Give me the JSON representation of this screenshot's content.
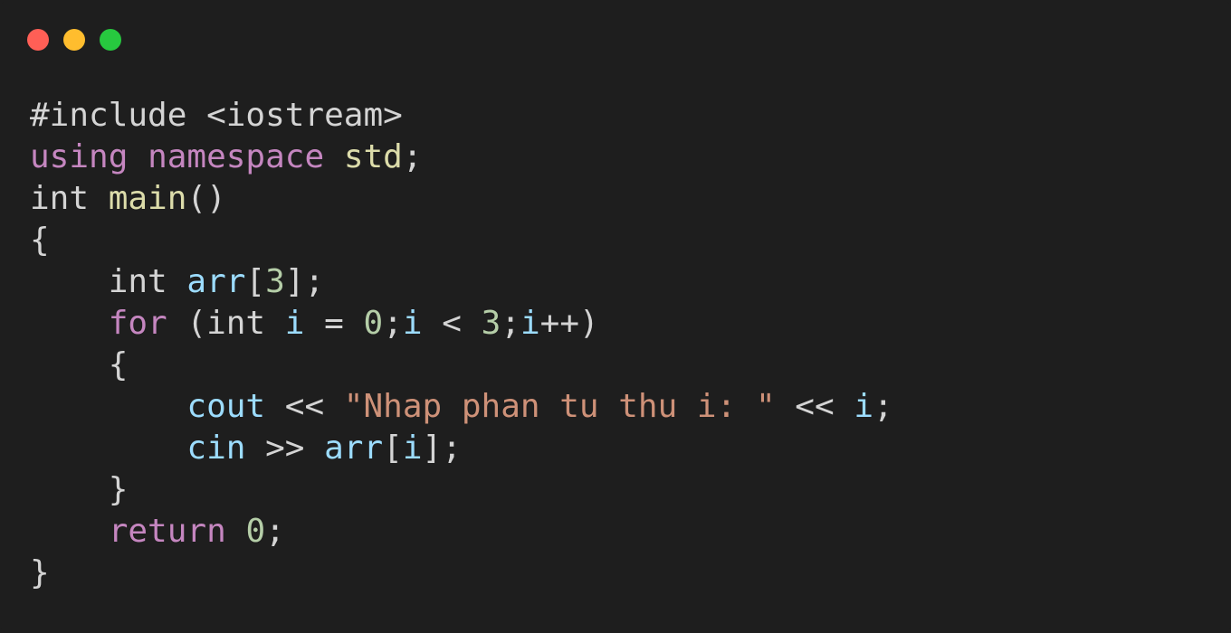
{
  "window": {
    "controls": [
      {
        "name": "close",
        "color": "#ff5f56"
      },
      {
        "name": "minimize",
        "color": "#ffbd2e"
      },
      {
        "name": "zoom",
        "color": "#27c93f"
      }
    ]
  },
  "code": {
    "language": "cpp",
    "lines": [
      [
        {
          "t": "#include <iostream>",
          "c": "plain"
        }
      ],
      [
        {
          "t": "using",
          "c": "kw"
        },
        {
          "t": " ",
          "c": "plain"
        },
        {
          "t": "namespace",
          "c": "kw"
        },
        {
          "t": " ",
          "c": "plain"
        },
        {
          "t": "std",
          "c": "fn"
        },
        {
          "t": ";",
          "c": "plain"
        }
      ],
      [
        {
          "t": "int ",
          "c": "plain"
        },
        {
          "t": "main",
          "c": "fn"
        },
        {
          "t": "()",
          "c": "plain"
        }
      ],
      [
        {
          "t": "{",
          "c": "plain"
        }
      ],
      [
        {
          "t": "    int ",
          "c": "plain"
        },
        {
          "t": "arr",
          "c": "var"
        },
        {
          "t": "[",
          "c": "plain"
        },
        {
          "t": "3",
          "c": "num"
        },
        {
          "t": "];",
          "c": "plain"
        }
      ],
      [
        {
          "t": "    ",
          "c": "plain"
        },
        {
          "t": "for",
          "c": "kw"
        },
        {
          "t": " (int ",
          "c": "plain"
        },
        {
          "t": "i",
          "c": "var"
        },
        {
          "t": " = ",
          "c": "plain"
        },
        {
          "t": "0",
          "c": "num"
        },
        {
          "t": ";",
          "c": "plain"
        },
        {
          "t": "i",
          "c": "var"
        },
        {
          "t": " < ",
          "c": "plain"
        },
        {
          "t": "3",
          "c": "num"
        },
        {
          "t": ";",
          "c": "plain"
        },
        {
          "t": "i",
          "c": "var"
        },
        {
          "t": "++)",
          "c": "plain"
        }
      ],
      [
        {
          "t": "    {",
          "c": "plain"
        }
      ],
      [
        {
          "t": "        ",
          "c": "plain"
        },
        {
          "t": "cout",
          "c": "var"
        },
        {
          "t": " << ",
          "c": "plain"
        },
        {
          "t": "\"Nhap phan tu thu i: \"",
          "c": "str"
        },
        {
          "t": " << ",
          "c": "plain"
        },
        {
          "t": "i",
          "c": "var"
        },
        {
          "t": ";",
          "c": "plain"
        }
      ],
      [
        {
          "t": "        ",
          "c": "plain"
        },
        {
          "t": "cin",
          "c": "var"
        },
        {
          "t": " >> ",
          "c": "plain"
        },
        {
          "t": "arr",
          "c": "var"
        },
        {
          "t": "[",
          "c": "plain"
        },
        {
          "t": "i",
          "c": "var"
        },
        {
          "t": "];",
          "c": "plain"
        }
      ],
      [
        {
          "t": "    }",
          "c": "plain"
        }
      ],
      [
        {
          "t": "    ",
          "c": "plain"
        },
        {
          "t": "return",
          "c": "kw"
        },
        {
          "t": " ",
          "c": "plain"
        },
        {
          "t": "0",
          "c": "num"
        },
        {
          "t": ";",
          "c": "plain"
        }
      ],
      [
        {
          "t": "}",
          "c": "plain"
        }
      ]
    ]
  }
}
